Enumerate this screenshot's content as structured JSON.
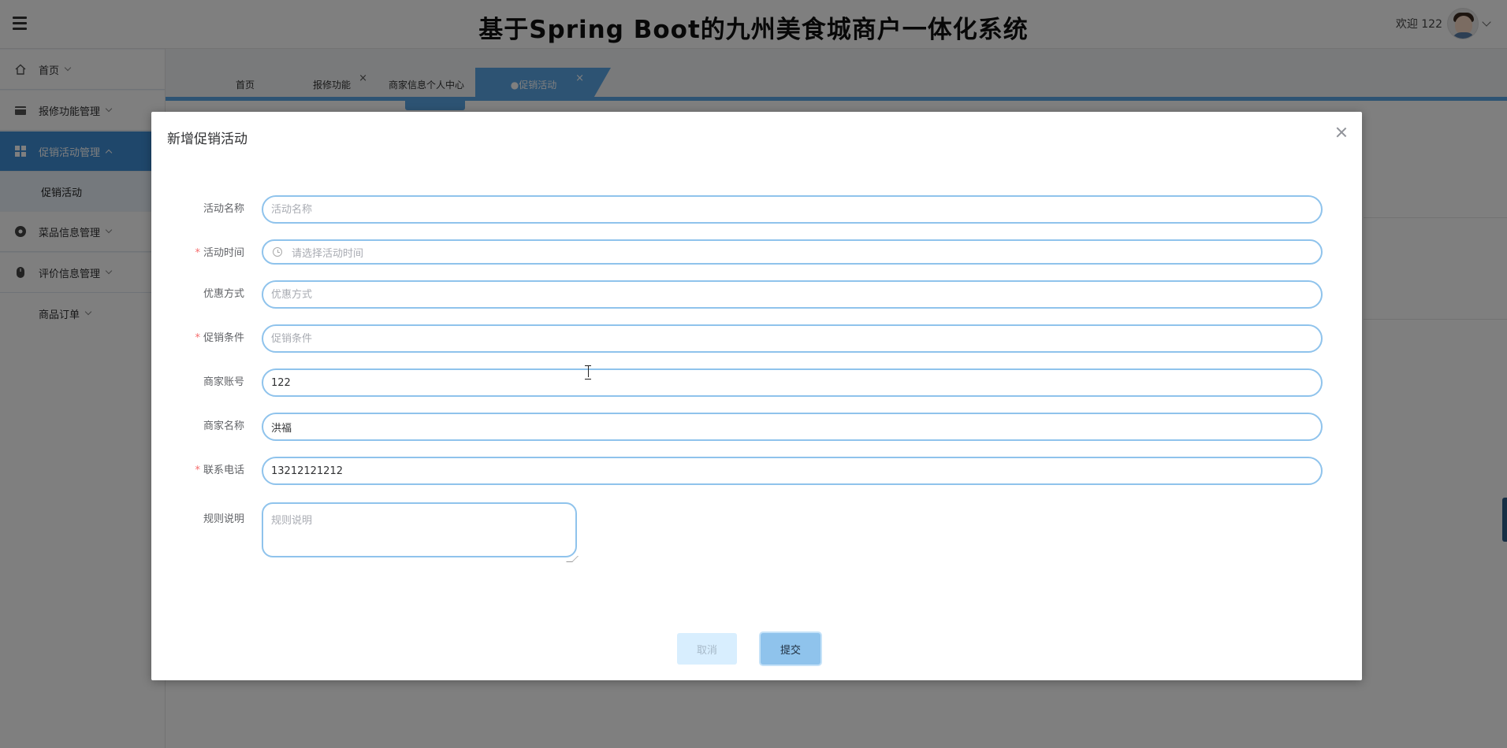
{
  "header": {
    "title": "基于Spring Boot的九州美食城商户一体化系统",
    "welcome": "欢迎 122"
  },
  "sidebar": {
    "items": [
      {
        "label": "首页",
        "icon": "home-icon"
      },
      {
        "label": "报修功能管理",
        "icon": "folder-icon"
      },
      {
        "label": "促销活动管理",
        "icon": "grid-icon",
        "active": true
      },
      {
        "label": "促销活动",
        "sub": true
      },
      {
        "label": "菜品信息管理",
        "icon": "circle-icon"
      },
      {
        "label": "评价信息管理",
        "icon": "mouse-icon"
      },
      {
        "label": "商品订单",
        "plain": true
      }
    ]
  },
  "tabs": [
    {
      "label": "首页"
    },
    {
      "label": "报修功能"
    },
    {
      "label": "商家信息个人中心"
    },
    {
      "label": "●促销活动",
      "active": true
    }
  ],
  "dialog": {
    "title": "新增促销活动",
    "fields": {
      "activity_name": {
        "label": "活动名称",
        "placeholder": "活动名称",
        "value": "",
        "required": false
      },
      "activity_time": {
        "label": "活动时间",
        "placeholder": "请选择活动时间",
        "required": true
      },
      "discount_method": {
        "label": "优惠方式",
        "placeholder": "优惠方式",
        "value": "",
        "required": false
      },
      "promo_condition": {
        "label": "促销条件",
        "placeholder": "促销条件",
        "value": "",
        "required": true
      },
      "merchant_account": {
        "label": "商家账号",
        "placeholder": "",
        "value": "122",
        "required": false
      },
      "merchant_name": {
        "label": "商家名称",
        "placeholder": "",
        "value": "洪福",
        "required": false
      },
      "phone": {
        "label": "联系电话",
        "placeholder": "",
        "value": "13212121212",
        "required": true
      },
      "rules": {
        "label": "规则说明",
        "placeholder": "规则说明",
        "value": "",
        "required": false
      }
    },
    "buttons": {
      "cancel": "取消",
      "submit": "提交"
    }
  },
  "colors": {
    "accent": "#5aa6e6",
    "input_border": "#8fc3ec",
    "required": "#f56c6c"
  }
}
